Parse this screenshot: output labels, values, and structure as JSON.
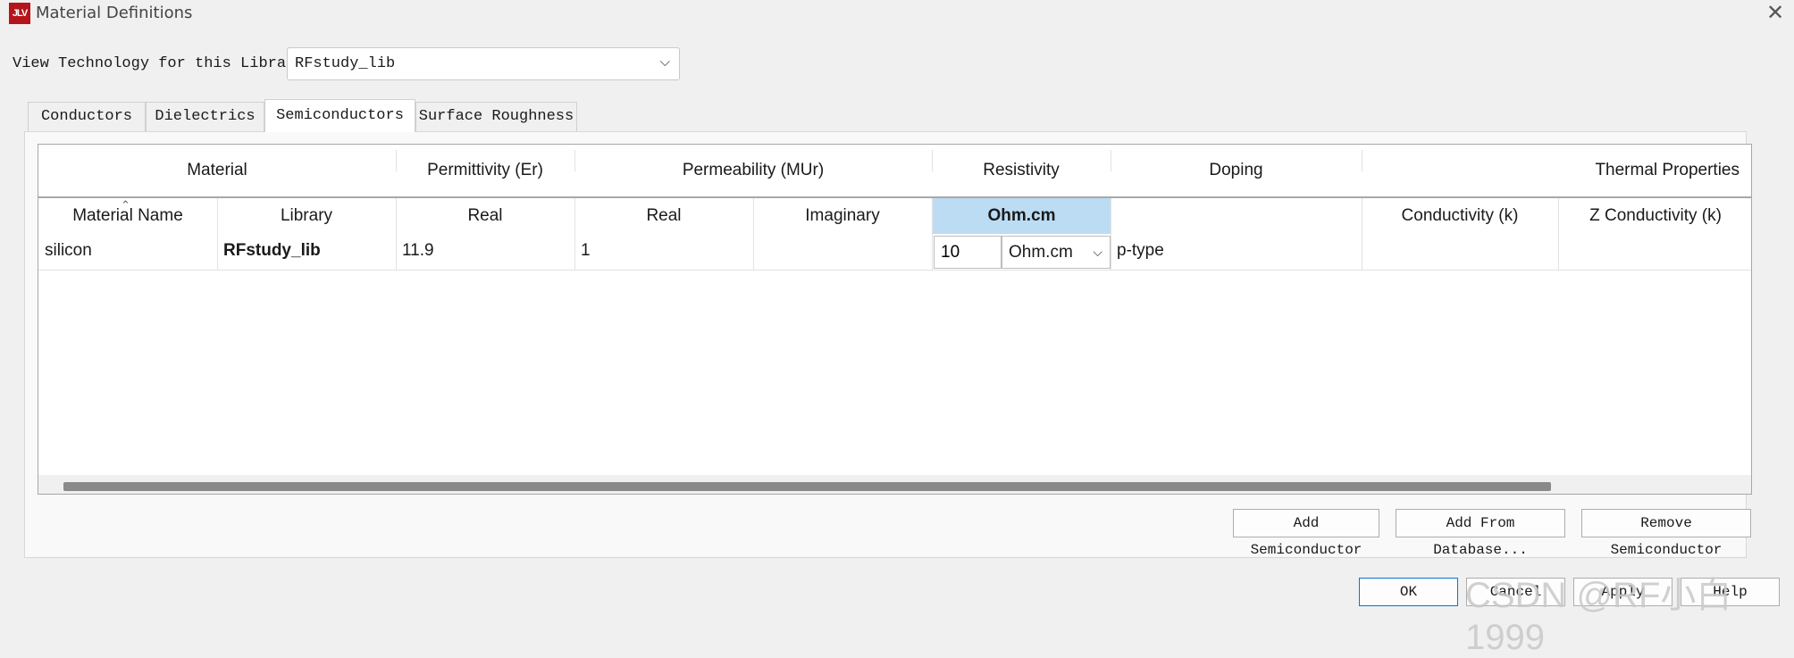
{
  "window": {
    "title": "Material Definitions",
    "icon_text": "JLV"
  },
  "library_selector": {
    "label": "View Technology for this Library:",
    "value": "RFstudy_lib"
  },
  "tabs": [
    {
      "label": "Conductors",
      "active": false
    },
    {
      "label": "Dielectrics",
      "active": false
    },
    {
      "label": "Semiconductors",
      "active": true
    },
    {
      "label": "Surface Roughness",
      "active": false
    }
  ],
  "table": {
    "group_headers": {
      "material": "Material",
      "permittivity": "Permittivity (Er)",
      "permeability": "Permeability (MUr)",
      "resistivity": "Resistivity",
      "doping": "Doping",
      "thermal": "Thermal Properties"
    },
    "column_headers": {
      "material_name": "Material Name",
      "library": "Library",
      "perm_real": "Real",
      "mu_real": "Real",
      "mu_imag": "Imaginary",
      "resistivity_unit": "Ohm.cm",
      "conductivity": "Conductivity (k)",
      "z_conductivity": "Z Conductivity (k)"
    },
    "rows": [
      {
        "material_name": "silicon",
        "library": "RFstudy_lib",
        "perm_real": "11.9",
        "mu_real": "1",
        "mu_imag": "",
        "resistivity_value": "10",
        "resistivity_unit": "Ohm.cm",
        "doping": "p-type",
        "conductivity": "",
        "z_conductivity": ""
      }
    ]
  },
  "actions": {
    "add": "Add Semiconductor",
    "add_db": "Add From Database...",
    "remove": "Remove Semiconductor"
  },
  "footer": {
    "ok": "OK",
    "cancel": "Cancel",
    "apply": "Apply",
    "help": "Help"
  },
  "watermark": "CSDN @RF小白1999",
  "colors": {
    "selected_header": "#bcdcf4",
    "primary_border": "#0078d7",
    "icon_bg": "#b5141b"
  }
}
